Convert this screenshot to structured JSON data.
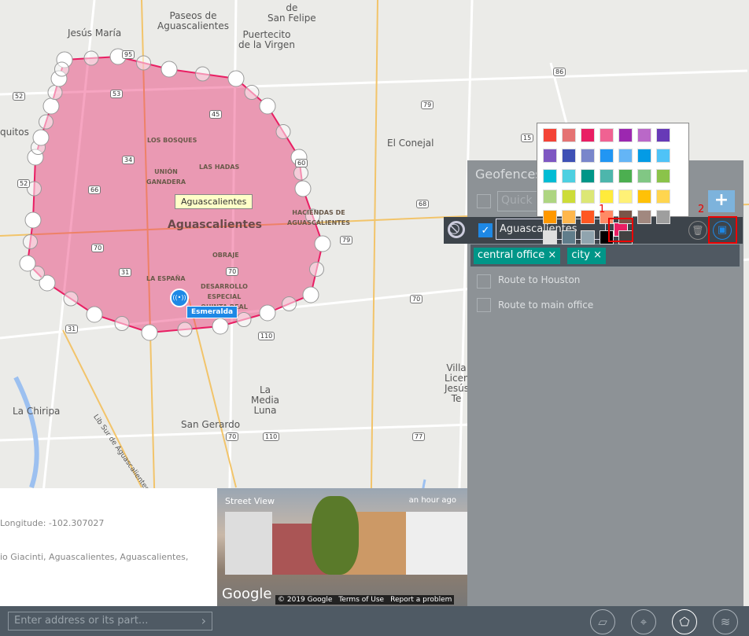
{
  "map": {
    "labels": [
      "Paseos de",
      "Aguascalientes",
      "San Felipe",
      "Jesús María",
      "Puertecito",
      "de la Virgen",
      "El Conejal",
      "quitos",
      "LOS BOSQUES",
      "UNIÓN GANADERA",
      "LAS HADAS",
      "Aguascalientes",
      "HACIENDAS DE AGUASCALIENTES",
      "OBRAJE",
      "LA ESPAÑA",
      "DESARROLLO ESPECIAL QUINTA REAL",
      "La Media Luna",
      "San Gerardo",
      "La Chiripa",
      "Villa Licencia Jesús Te",
      "Lib Sur de Aguascalientes",
      "de"
    ],
    "shields": [
      "95",
      "53",
      "45",
      "52",
      "34",
      "66",
      "70",
      "31",
      "110",
      "86",
      "79",
      "60",
      "68",
      "15",
      "77",
      "79",
      "70",
      "70",
      "110",
      "70",
      "31",
      "52"
    ],
    "tooltip": "Aguascalientes",
    "marker_label": "Esmeralda",
    "geofence_color": "#e91e63"
  },
  "panel": {
    "title": "Geofences",
    "quick_search_placeholder": "Quick S",
    "add_label": "+",
    "edit_row": {
      "name": "Aguascalientes",
      "color": "#e91e63",
      "tags": [
        "central office",
        "city"
      ],
      "tag_remove": "×"
    },
    "items": [
      "Route to Houston",
      "Route to main office"
    ],
    "annotations": [
      "1",
      "2"
    ]
  },
  "palette": [
    "#f44336",
    "#e57373",
    "#e91e63",
    "#f06292",
    "#9c27b0",
    "#ba68c8",
    "#673ab7",
    "#7e57c2",
    "#3f51b5",
    "#7986cb",
    "#2196f3",
    "#64b5f6",
    "#039be5",
    "#4fc3f7",
    "#00bcd4",
    "#4dd0e1",
    "#009688",
    "#4db6ac",
    "#4caf50",
    "#81c784",
    "#8bc34a",
    "#aed581",
    "#cddc39",
    "#dce775",
    "#ffeb3b",
    "#fff176",
    "#ffc107",
    "#ffd54f",
    "#ff9800",
    "#ffb74d",
    "#ff5722",
    "#ff8a65",
    "#795548",
    "#a1887f",
    "#9e9e9e",
    "#e0e0e0",
    "#607d8b",
    "#90a4ae",
    "#000000",
    "#424242"
  ],
  "info": {
    "longitude": "Longitude: -102.307027",
    "address": "io Giacinti, Aguascalientes, Aguascalientes,"
  },
  "streetview": {
    "title": "Street View",
    "time": "an hour ago",
    "logo": "Google",
    "copyright": "© 2019 Google",
    "terms": "Terms of Use",
    "report": "Report a problem"
  },
  "footer": {
    "address_placeholder": "Enter address or its part...",
    "go": "›"
  }
}
